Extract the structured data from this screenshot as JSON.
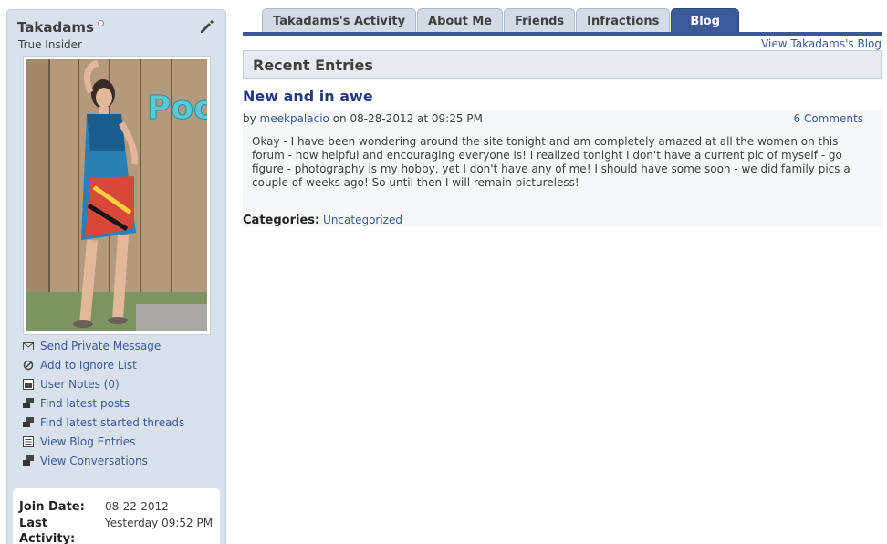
{
  "profile": {
    "username": "Takadams",
    "user_title": "True Insider",
    "actions": [
      {
        "label": "Send Private Message",
        "icon": "envelope-icon"
      },
      {
        "label": "Add to Ignore List",
        "icon": "block-icon"
      },
      {
        "label": "User Notes (0)",
        "icon": "notes-icon"
      },
      {
        "label": "Find latest posts",
        "icon": "posts-icon"
      },
      {
        "label": "Find latest started threads",
        "icon": "threads-icon"
      },
      {
        "label": "View Blog Entries",
        "icon": "blog-icon"
      },
      {
        "label": "View Conversations",
        "icon": "conversations-icon"
      }
    ],
    "info": {
      "join_date_label": "Join Date:",
      "join_date": "08-22-2012",
      "last_activity_label_1": "Last",
      "last_activity_label_2": "Activity:",
      "last_activity": "Yesterday 09:52 PM"
    }
  },
  "tabs": [
    {
      "label": "Takadams's Activity",
      "active": false
    },
    {
      "label": "About Me",
      "active": false
    },
    {
      "label": "Friends",
      "active": false
    },
    {
      "label": "Infractions",
      "active": false
    },
    {
      "label": "Blog",
      "active": true
    }
  ],
  "blog": {
    "view_link": "View Takadams's Blog",
    "section_title": "Recent Entries",
    "entry": {
      "title": "New and in awe",
      "by": "by",
      "author": "meekpalacio",
      "date_text": "on 08-28-2012 at 09:25 PM",
      "comments": "6 Comments",
      "body": "Okay - I have been wondering around the site tonight and am completely amazed at all the women on this forum - how helpful and encouraging everyone is! I realized tonight I don't have a current pic of myself - go figure - photography is my hobby, yet I don't have any of me! I should have some soon - we did family pics a couple of weeks ago! So until then I will remain pictureless!",
      "categories_label": "Categories:",
      "category": "Uncategorized"
    }
  },
  "colors": {
    "accent": "#3b5998",
    "link": "#3a5a96",
    "title": "#22397f",
    "sidebar_bg": "#d9e1ec"
  }
}
